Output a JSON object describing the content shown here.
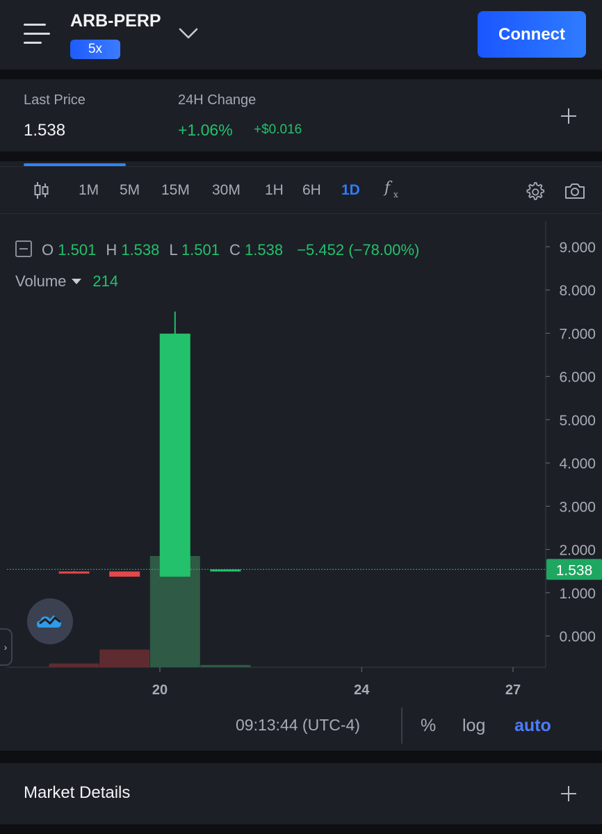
{
  "header": {
    "market": "ARB-PERP",
    "leverage": "5x",
    "connect_label": "Connect"
  },
  "price": {
    "last_price_label": "Last Price",
    "last_price": "1.538",
    "change_label": "24H Change",
    "change_pct": "+1.06%",
    "change_abs": "+$0.016"
  },
  "toolbar": {
    "timeframes": [
      "1M",
      "5M",
      "15M",
      "30M",
      "1H",
      "6H",
      "1D"
    ],
    "active_timeframe": "1D"
  },
  "legend": {
    "o_label": "O",
    "o": "1.501",
    "h_label": "H",
    "h": "1.538",
    "l_label": "L",
    "l": "1.501",
    "c_label": "C",
    "c": "1.538",
    "change": "−5.452 (−78.00%)",
    "volume_label": "Volume",
    "volume": "214"
  },
  "bottom": {
    "clock": "09:13:44 (UTC-4)",
    "percent": "%",
    "log": "log",
    "auto": "auto"
  },
  "details": {
    "title": "Market Details"
  },
  "colors": {
    "up": "#23c16b",
    "down": "#e6474a",
    "accent": "#2f7df6",
    "panel": "#1c1f26"
  },
  "chart_data": {
    "type": "candlestick",
    "price_axis_ticks": [
      "9.000",
      "8.000",
      "7.000",
      "6.000",
      "5.000",
      "4.000",
      "3.000",
      "2.000",
      "1.000",
      "0.000"
    ],
    "time_axis_ticks": [
      "20",
      "24",
      "27"
    ],
    "last_price_label": "1.538",
    "ylim": [
      -0.7,
      9.5
    ],
    "candles": [
      {
        "x": 18.3,
        "open": 1.49,
        "high": 1.5,
        "low": 1.45,
        "close": 1.45
      },
      {
        "x": 19.3,
        "open": 1.49,
        "high": 1.49,
        "low": 1.37,
        "close": 1.37
      },
      {
        "x": 20.3,
        "open": 1.37,
        "high": 7.5,
        "low": 1.37,
        "close": 6.99
      },
      {
        "x": 21.3,
        "open": 1.5,
        "high": 1.54,
        "low": 1.5,
        "close": 1.538
      }
    ],
    "volume": [
      {
        "x": 18.3,
        "value": 0.2,
        "dir": "down"
      },
      {
        "x": 19.3,
        "value": 0.95,
        "dir": "down"
      },
      {
        "x": 20.3,
        "value": 6.0,
        "dir": "up"
      },
      {
        "x": 21.3,
        "value": 0.12,
        "dir": "up"
      }
    ],
    "volume_max": 7.0
  }
}
